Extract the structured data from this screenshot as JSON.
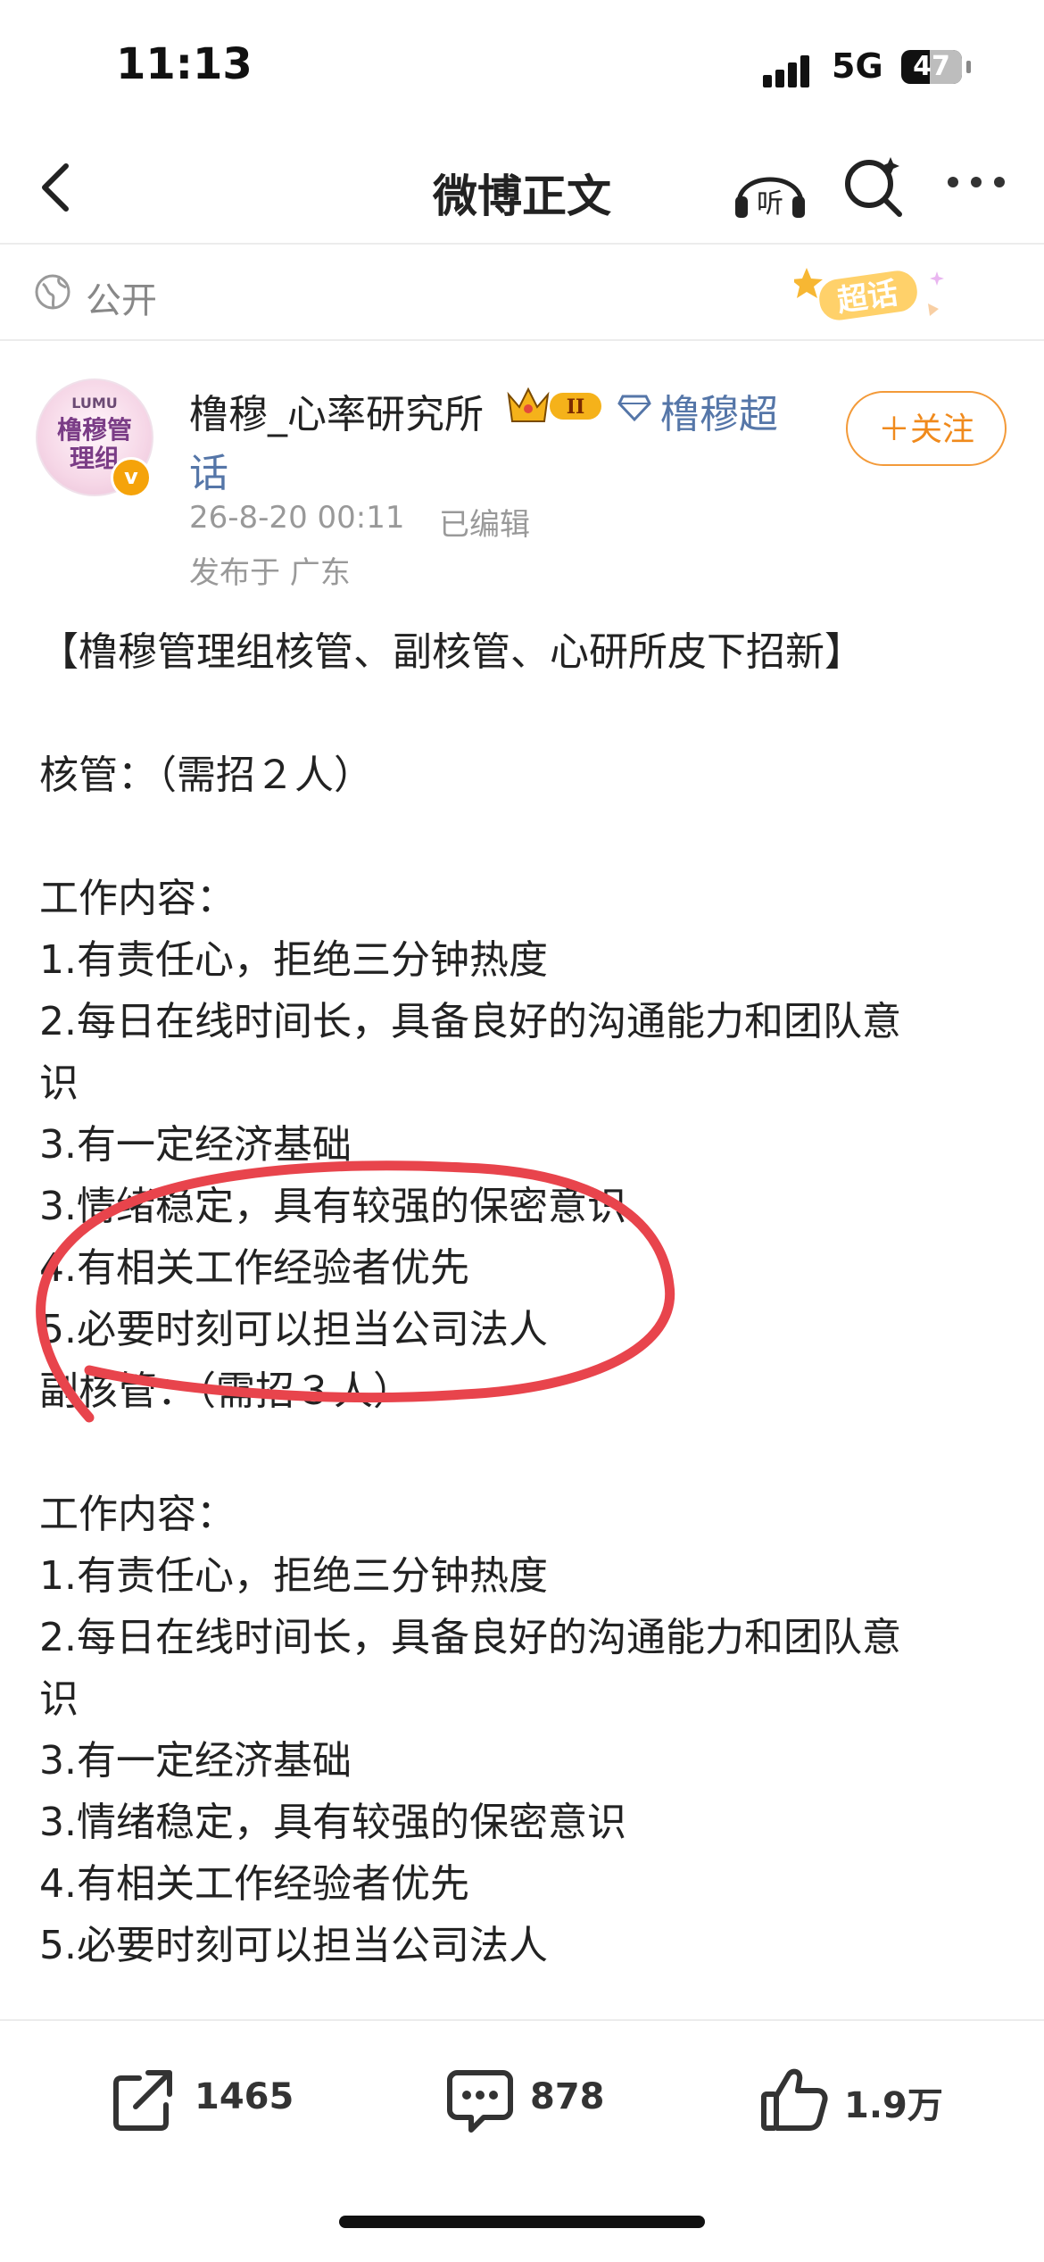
{
  "status_bar": {
    "time": "11:13",
    "network": "5G",
    "battery": "47",
    "battery_level": 0.47
  },
  "nav": {
    "title": "微博正文",
    "listen_label": "听"
  },
  "visibility": {
    "label": "公开",
    "supertopic_badge": "超话"
  },
  "author": {
    "avatar_top": "LUMU",
    "avatar_text": "橹穆管理组",
    "verified_badge": "v",
    "name": "橹穆_心率研究所",
    "level_badge": "II",
    "supertopic_line1": "橹穆超",
    "supertopic_line2": "话",
    "time": "26-8-20 00:11",
    "edited": "已编辑",
    "location": "发布于 广东",
    "follow_label": "＋关注"
  },
  "post": {
    "lines": [
      "【橹穆管理组核管、副核管、心研所皮下招新】",
      "",
      "核管：（需招２人）",
      "",
      "工作内容：",
      "1.有责任心，拒绝三分钟热度",
      "2.每日在线时间长，具备良好的沟通能力和团队意",
      "识",
      "3.有一定经济基础",
      "3.情绪稳定，具有较强的保密意识",
      "4.有相关工作经验者优先",
      "5.必要时刻可以担当公司法人",
      "副核管：（需招３人）",
      "",
      "工作内容：",
      "1.有责任心，拒绝三分钟热度",
      "2.每日在线时间长，具备良好的沟通能力和团队意",
      "识",
      "3.有一定经济基础",
      "3.情绪稳定，具有较强的保密意识",
      "4.有相关工作经验者优先",
      "5.必要时刻可以担当公司法人"
    ]
  },
  "actions": {
    "reposts": "1465",
    "comments": "878",
    "likes": "1.9万"
  },
  "colors": {
    "accent": "#f08a1c",
    "link": "#5576a8",
    "annotation": "#e8444c",
    "meta": "#999999"
  }
}
